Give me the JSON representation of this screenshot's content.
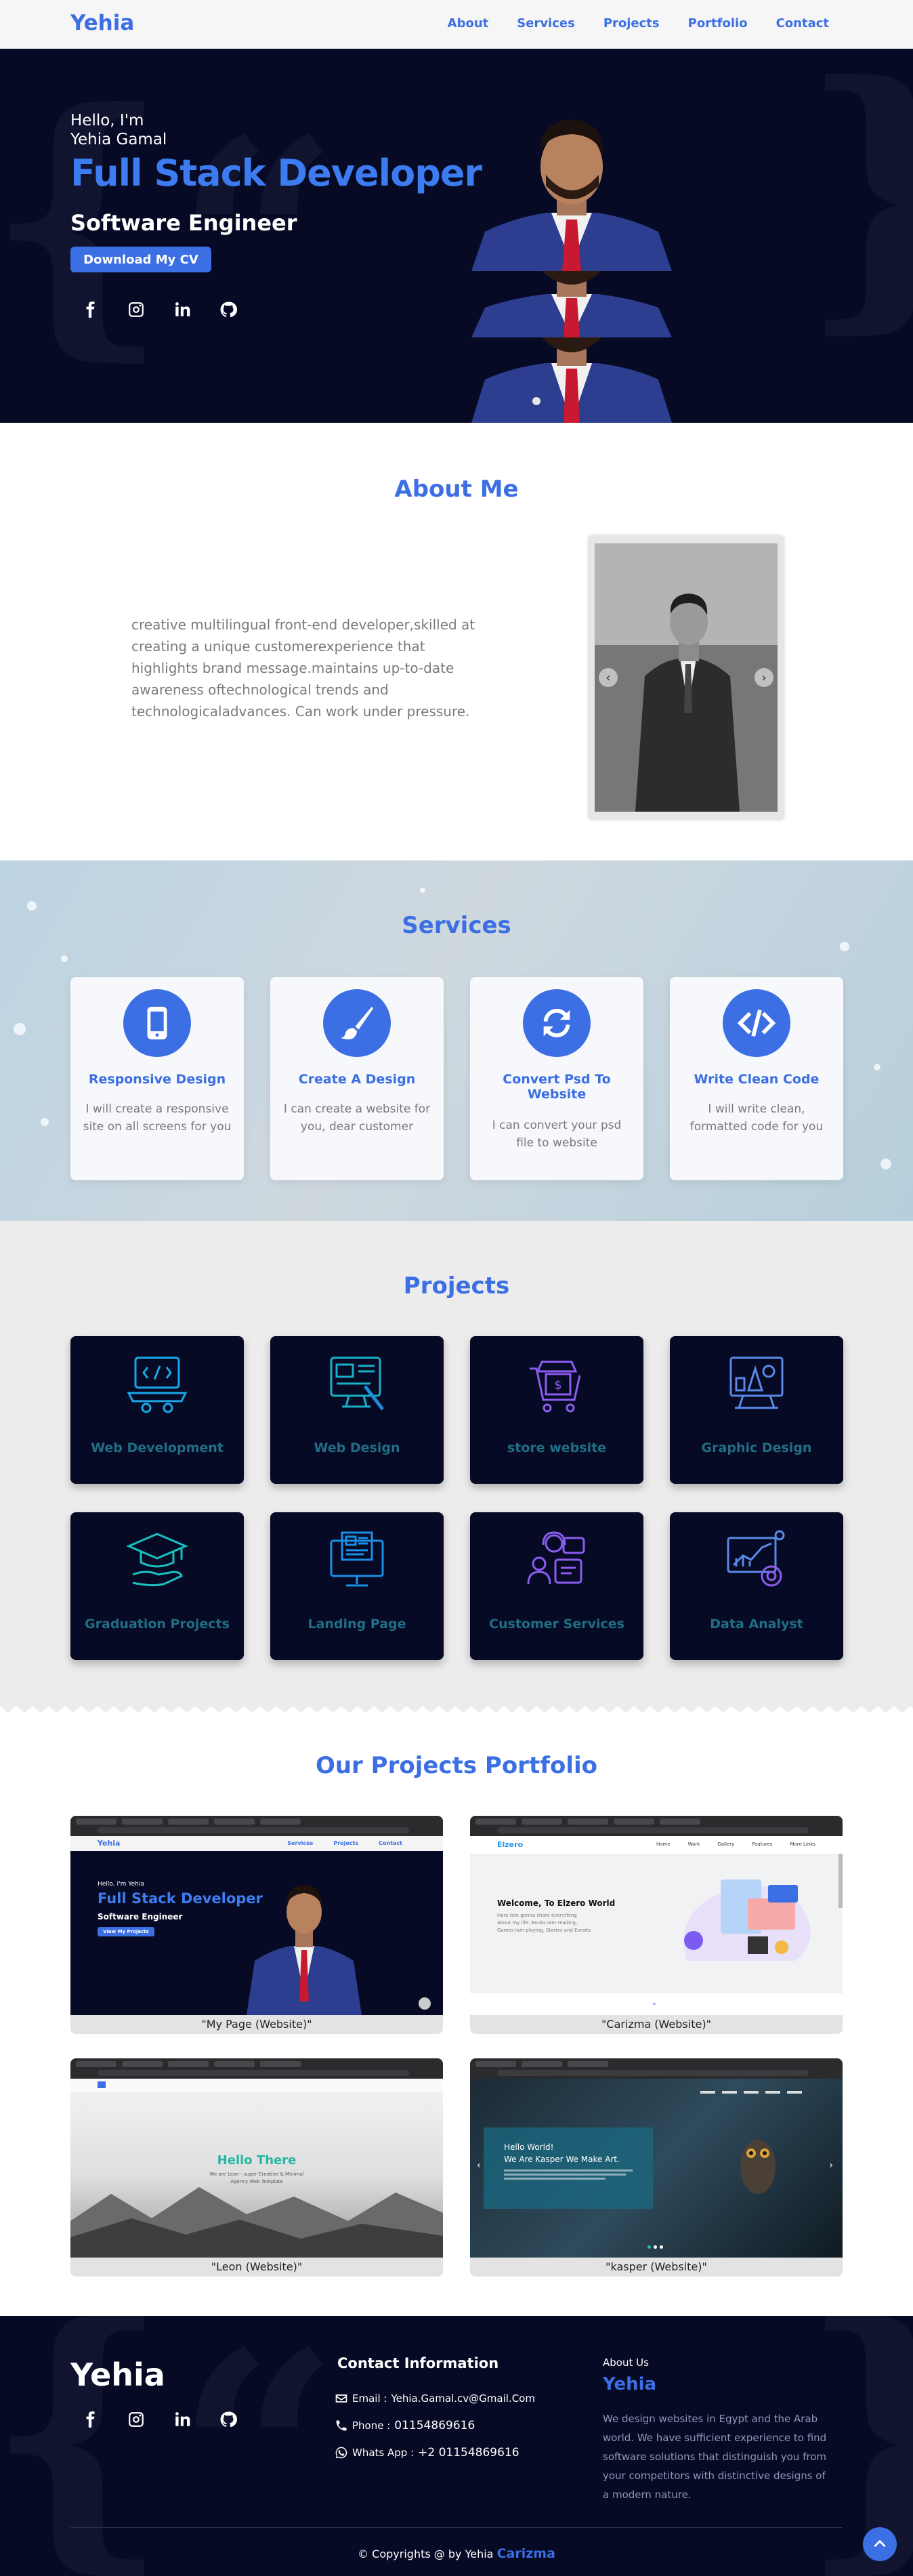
{
  "nav": {
    "logo": "Yehia",
    "links": [
      "About",
      "Services",
      "Projects",
      "Portfolio",
      "Contact"
    ]
  },
  "hero": {
    "hello_line1": "Hello, I'm",
    "hello_line2": "Yehia Gamal",
    "title": "Full Stack Developer",
    "subtitle": "Software Engineer",
    "cv_button": "Download My CV",
    "social_icons": [
      "facebook-icon",
      "instagram-icon",
      "linkedin-icon",
      "github-icon"
    ]
  },
  "about": {
    "title": "About Me",
    "text": "creative multilingual front-end developer,skilled at creating a unique customerexperience that highlights brand message.maintains up-to-date awareness oftechnological trends and technologicaladvances. Can work under pressure.",
    "prev": "‹",
    "next": "›"
  },
  "services": {
    "title": "Services",
    "items": [
      {
        "title": "Responsive Design",
        "desc": "I will create a responsive site on all screens for you",
        "icon": "mobile-icon"
      },
      {
        "title": "Create A Design",
        "desc": "I can create a website for you, dear customer",
        "icon": "brush-icon"
      },
      {
        "title": "Convert Psd To Website",
        "desc": "I can convert your psd file to website",
        "icon": "sync-icon"
      },
      {
        "title": "Write Clean Code",
        "desc": "I will write clean, formatted code for you",
        "icon": "code-icon"
      }
    ]
  },
  "projects": {
    "title": "Projects",
    "items": [
      {
        "label": "Web Development",
        "icon": "laptop-code-icon"
      },
      {
        "label": "Web Design",
        "icon": "web-design-icon"
      },
      {
        "label": "store website",
        "icon": "store-cart-icon"
      },
      {
        "label": "Graphic Design",
        "icon": "graphic-design-icon"
      },
      {
        "label": "Graduation Projects",
        "icon": "graduation-cap-icon"
      },
      {
        "label": "Landing Page",
        "icon": "landing-page-icon"
      },
      {
        "label": "Customer Services",
        "icon": "customer-service-icon"
      },
      {
        "label": "Data Analyst",
        "icon": "data-analytics-icon"
      }
    ]
  },
  "portfolio": {
    "title": "Our Projects Portfolio",
    "items": [
      {
        "caption": "\"My Page (Website)\"",
        "logo": "Yehia",
        "menu": [
          "Services",
          "Projects",
          "Contact"
        ],
        "hello": "Hello, I'm Yehia",
        "title": "Full Stack Developer",
        "subtitle": "Software Engineer",
        "button": "View My Projects"
      },
      {
        "caption": "\"Carizma (Website)\"",
        "logo": "Elzero",
        "menu": [
          "Home",
          "Work",
          "Gallery",
          "Features",
          "More Links"
        ],
        "heading": "Welcome, To Elzero World",
        "body": "Here Iam gonna share everything about my life. Books Iam reading, Games Iam playing, Stories and Events"
      },
      {
        "caption": "\"Leon (Website)\"",
        "heading": "Hello There",
        "body": "We are Leon - super Creative & Minimal Agency Web Template"
      },
      {
        "caption": "\"kasper (Website)\"",
        "heading1": "Hello World!",
        "heading2": "We Are Kasper We Make Art."
      }
    ]
  },
  "footer": {
    "logo": "Yehia",
    "contact_title": "Contact Information",
    "email_label": "Email :",
    "email": "Yehia.Gamal.cv@Gmail.Com",
    "phone_label": "Phone :",
    "phone": "01154869616",
    "whatsapp_label": "Whats App :",
    "whatsapp": "+2 01154869616",
    "about_title": "About Us",
    "about_name": "Yehia",
    "about_text": "We design websites in Egypt and the Arab world. We have sufficient experience to find software solutions that distinguish you from your competitors with distinctive designs of a modern nature.",
    "copyright": "© Copyrights @ by Yehia",
    "copyright_brand": "Carizma"
  },
  "colors": {
    "accent": "#3b6fe3",
    "hero_bg": "#070a24",
    "project_label": "#1f6f86"
  }
}
